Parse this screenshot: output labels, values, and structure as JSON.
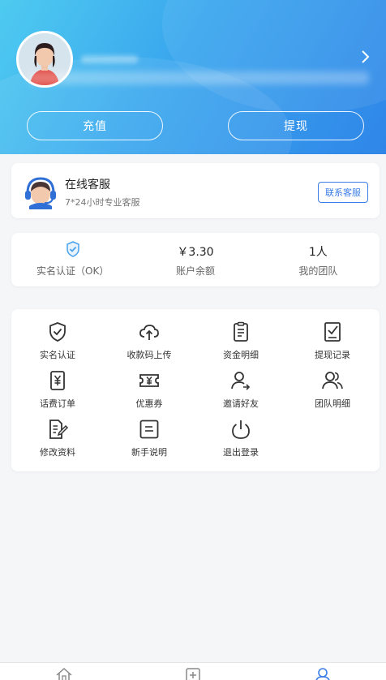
{
  "header": {
    "recharge_label": "充值",
    "withdraw_label": "提现"
  },
  "service": {
    "title": "在线客服",
    "subtitle": "7*24小时专业客服",
    "contact_label": "联系客服"
  },
  "stats": [
    {
      "value": "",
      "label": "实名认证（OK）"
    },
    {
      "value": "￥3.30",
      "label": "账户余额"
    },
    {
      "value": "1人",
      "label": "我的团队"
    }
  ],
  "menu": [
    {
      "label": "实名认证",
      "icon": "shield-check-icon"
    },
    {
      "label": "收款码上传",
      "icon": "cloud-upload-icon"
    },
    {
      "label": "资金明细",
      "icon": "clipboard-list-icon"
    },
    {
      "label": "提现记录",
      "icon": "checklist-icon"
    },
    {
      "label": "话费订单",
      "icon": "yuan-receipt-icon"
    },
    {
      "label": "优惠券",
      "icon": "coupon-icon"
    },
    {
      "label": "邀请好友",
      "icon": "invite-user-icon"
    },
    {
      "label": "团队明细",
      "icon": "team-icon"
    },
    {
      "label": "修改资料",
      "icon": "edit-document-icon"
    },
    {
      "label": "新手说明",
      "icon": "guide-icon"
    },
    {
      "label": "退出登录",
      "icon": "power-icon"
    }
  ],
  "colors": {
    "accent": "#3a7de6",
    "header_start": "#4ecbf0",
    "header_end": "#2f86e8"
  }
}
